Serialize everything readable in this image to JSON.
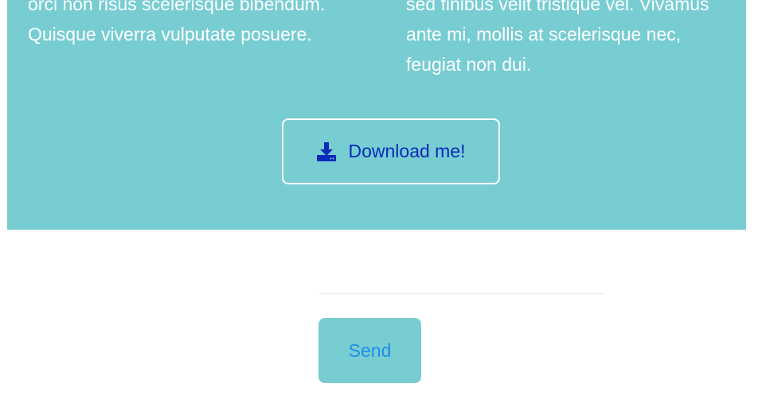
{
  "content_section": {
    "left_column_lines": [
      "orci non risus scelerisque bibendum.",
      "Quisque viverra vulputate posuere."
    ],
    "right_column_lines": [
      "sed finibus velit tristique vel. Vivamus",
      "ante mi, mollis at scelerisque nec,",
      "feugiat non dui."
    ],
    "download_button": {
      "label": "Download me!",
      "icon": "download-icon"
    }
  },
  "form": {
    "send_label": "Send"
  },
  "colors": {
    "section_background": "#78cdd2",
    "download_label": "#0a2ab8",
    "send_label": "#1e8fe8",
    "divider": "#ececec"
  }
}
